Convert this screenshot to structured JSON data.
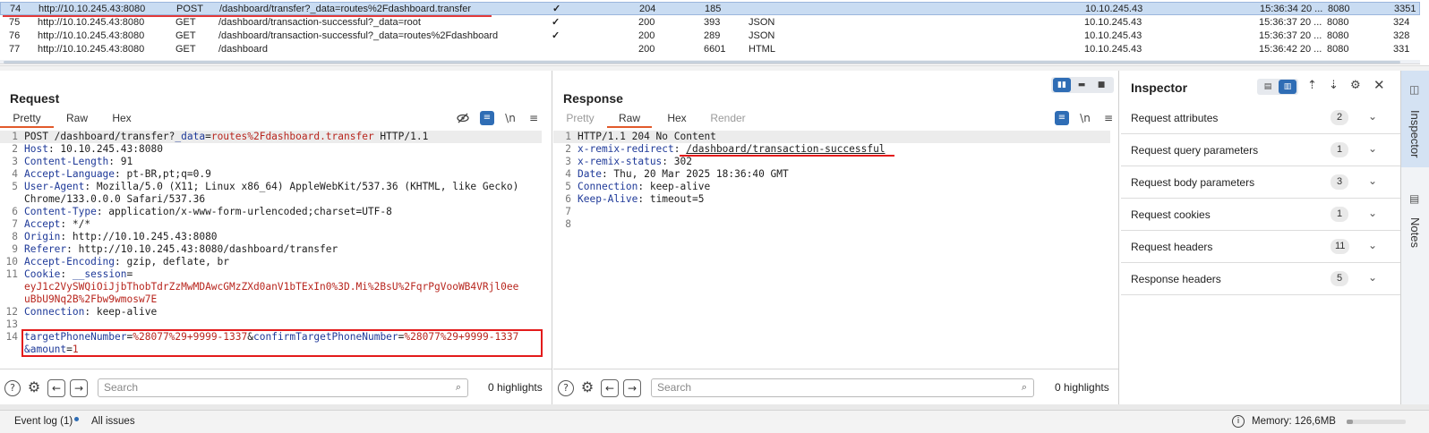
{
  "history": {
    "rows": [
      {
        "num": "74",
        "host": "http://10.10.245.43:8080",
        "method": "POST",
        "url": "/dashboard/transfer?_data=routes%2Fdashboard.transfer",
        "edited": "✓",
        "status": "204",
        "length": "185",
        "mime": "",
        "ip": "10.10.245.43",
        "time": "15:36:34 20 ...",
        "port": "8080",
        "id": "3351"
      },
      {
        "num": "75",
        "host": "http://10.10.245.43:8080",
        "method": "GET",
        "url": "/dashboard/transaction-successful?_data=root",
        "edited": "✓",
        "status": "200",
        "length": "393",
        "mime": "JSON",
        "ip": "10.10.245.43",
        "time": "15:36:37 20 ...",
        "port": "8080",
        "id": "324"
      },
      {
        "num": "76",
        "host": "http://10.10.245.43:8080",
        "method": "GET",
        "url": "/dashboard/transaction-successful?_data=routes%2Fdashboard",
        "edited": "✓",
        "status": "200",
        "length": "289",
        "mime": "JSON",
        "ip": "10.10.245.43",
        "time": "15:36:37 20 ...",
        "port": "8080",
        "id": "328"
      },
      {
        "num": "77",
        "host": "http://10.10.245.43:8080",
        "method": "GET",
        "url": "/dashboard",
        "edited": "",
        "status": "200",
        "length": "6601",
        "mime": "HTML",
        "ip": "10.10.245.43",
        "time": "15:36:42 20 ...",
        "port": "8080",
        "id": "331"
      }
    ]
  },
  "request": {
    "title": "Request",
    "tabs": [
      "Pretty",
      "Raw",
      "Hex"
    ],
    "icons": {
      "hide": "eye-slash-icon",
      "wrap": "wrap-icon",
      "newline": "\\n",
      "menu": "menu-icon"
    },
    "lines": {
      "l1_a": "POST /dashboard/transfer?",
      "l1_k": "_data",
      "l1_eq": "=",
      "l1_v": "routes%2Fdashboard.transfer",
      "l1_b": " HTTP/1.1",
      "l2_k": "Host",
      "l2_v": ": 10.10.245.43:8080",
      "l3_k": "Content-Length",
      "l3_v": ": 91",
      "l4_k": "Accept-Language",
      "l4_v": ": pt-BR,pt;q=0.9",
      "l5_k": "User-Agent",
      "l5_v": ": Mozilla/5.0 (X11; Linux x86_64) AppleWebKit/537.36 (KHTML, like Gecko)",
      "l5_cont": " Chrome/133.0.0.0 Safari/537.36",
      "l6_k": "Content-Type",
      "l6_v": ": application/x-www-form-urlencoded;charset=UTF-8",
      "l7_k": "Accept",
      "l7_v": ": */*",
      "l8_k": "Origin",
      "l8_v": ": http://10.10.245.43:8080",
      "l9_k": "Referer",
      "l9_v": ": http://10.10.245.43:8080/dashboard/transfer",
      "l10_k": "Accept-Encoding",
      "l10_v": ": gzip, deflate, br",
      "l11_k": "Cookie",
      "l11_sep": ": ",
      "l11_ck": "__session",
      "l11_eq": "=",
      "l11_c1": "eyJ1c2VySWQiOiJjbThobTdrZzMwMDAwcGMzZXd0anV1bTExIn0%3D.Mi%2BsU%2FqrPgVooWB4VRjl0ee",
      "l11_c2": "uBbU9Nq2B%2Fbw9wmosw7E",
      "l12_k": "Connection",
      "l12_v": ": keep-alive",
      "l14_k1": "targetPhoneNumber",
      "l14_v1": "%28077%29+9999-1337",
      "l14_amp1": "&",
      "l14_k2": "confirmTargetPhoneNumber",
      "l14_v2": "%28077%29+9999-1337",
      "l14_k3": "&amount",
      "l14_v3": "1",
      "eq": "="
    },
    "line_numbers": [
      "1",
      "2",
      "3",
      "4",
      "5",
      "6",
      "7",
      "8",
      "9",
      "10",
      "11",
      "12",
      "13",
      "14"
    ],
    "search_placeholder": "Search",
    "highlights": "0 highlights"
  },
  "response": {
    "title": "Response",
    "tabs": [
      "Pretty",
      "Raw",
      "Hex",
      "Render"
    ],
    "lines": {
      "l1": "HTTP/1.1 204 No Content",
      "l2_k": "x-remix-redirect",
      "l2_sep": ": ",
      "l2_v": "/dashboard/transaction-successful",
      "l3_k": "x-remix-status",
      "l3_v": ": 302",
      "l4_k": "Date",
      "l4_v": ": Thu, 20 Mar 2025 18:36:40 GMT",
      "l5_k": "Connection",
      "l5_v": ": keep-alive",
      "l6_k": "Keep-Alive",
      "l6_v": ": timeout=5"
    },
    "line_numbers": [
      "1",
      "2",
      "3",
      "4",
      "5",
      "6",
      "7",
      "8"
    ],
    "search_placeholder": "Search",
    "highlights": "0 highlights"
  },
  "inspector": {
    "title": "Inspector",
    "sections": [
      {
        "label": "Request attributes",
        "count": "2"
      },
      {
        "label": "Request query parameters",
        "count": "1"
      },
      {
        "label": "Request body parameters",
        "count": "3"
      },
      {
        "label": "Request cookies",
        "count": "1"
      },
      {
        "label": "Request headers",
        "count": "11"
      },
      {
        "label": "Response headers",
        "count": "5"
      }
    ]
  },
  "side_tabs": [
    "Inspector",
    "Notes"
  ],
  "status_bar": {
    "event_log": "Event log (1)",
    "all_issues": "All issues",
    "memory": "Memory: 126,6MB",
    "memory_used_fraction": 0.1
  },
  "colors": {
    "accent": "#e25a2b",
    "selection": "#c9dcf2",
    "annotation_red": "#e31b1b",
    "header_key": "#1f3a99",
    "param_value": "#b8261e"
  }
}
